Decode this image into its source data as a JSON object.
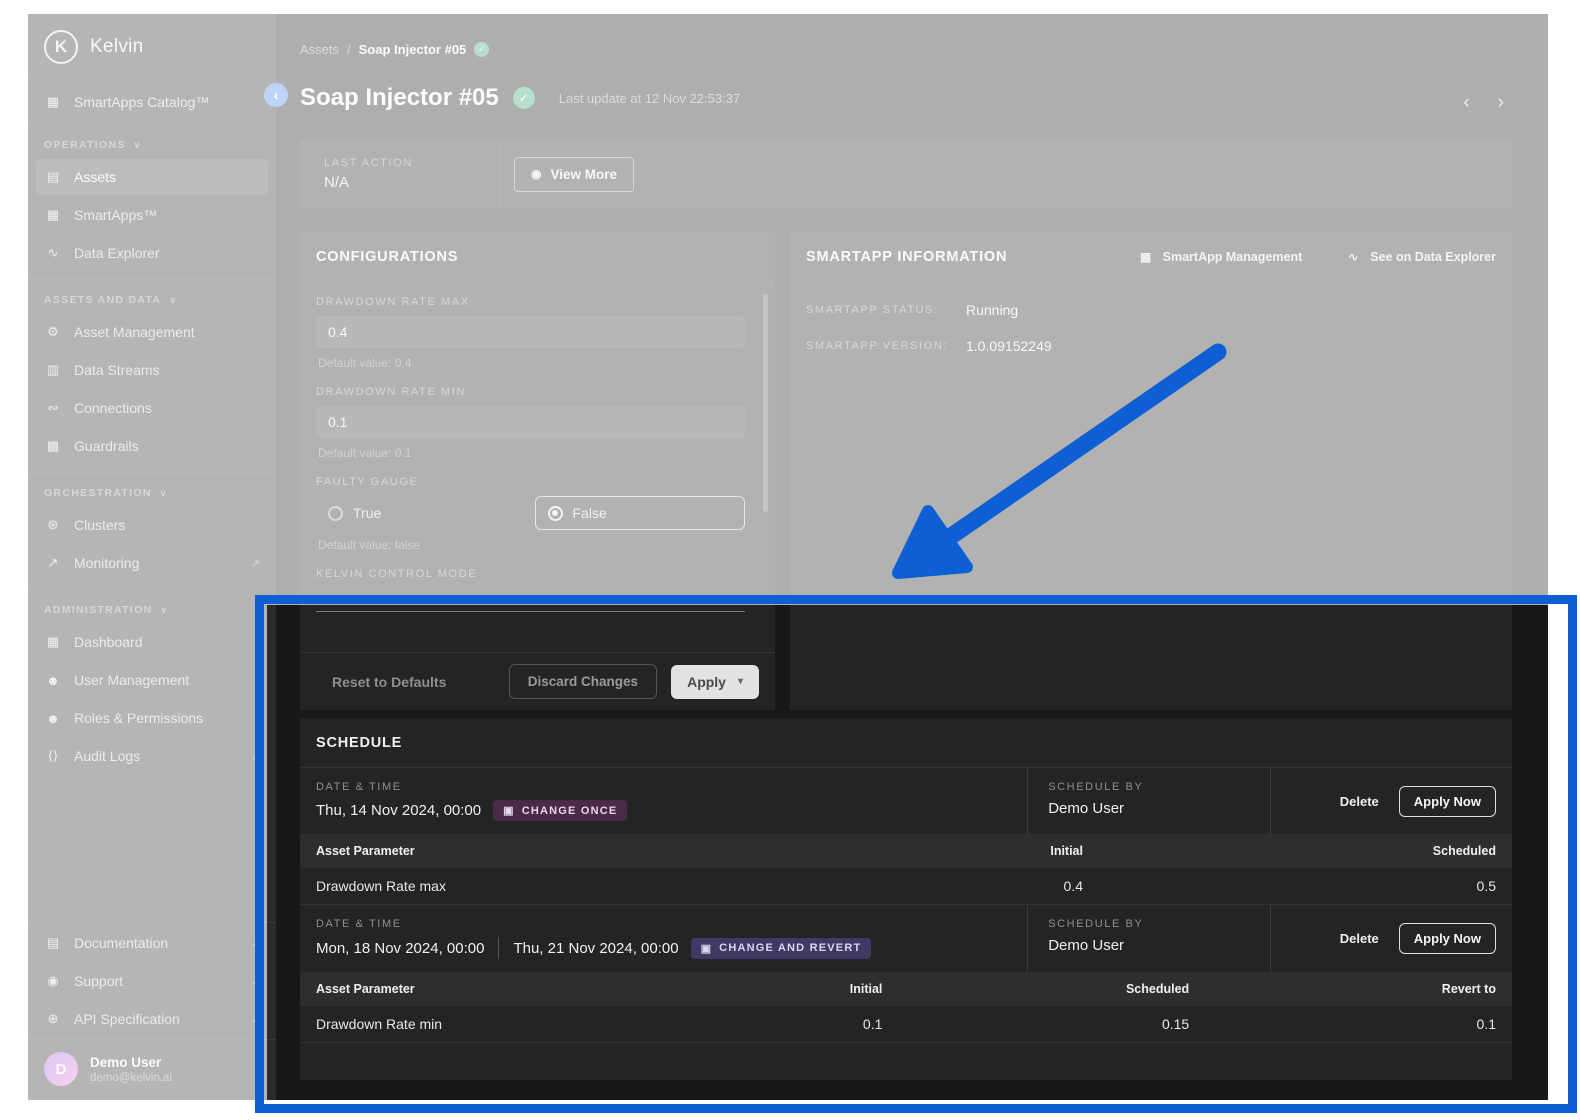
{
  "colors": {
    "annotation_blue": "#0d5fd3",
    "badge_change_once_bg": "#4a2949",
    "badge_change_revert_bg": "#3e3a63",
    "status_green": "#35a36f",
    "avatar_gradient": [
      "#a05fe0",
      "#e879c9"
    ]
  },
  "icons": {
    "logo_initial": "K",
    "collapse": "‹",
    "catalog": "▦",
    "chevron_down": "∨",
    "assets": "▤",
    "smartapps": "▦",
    "data_explorer": "∿",
    "asset_management": "⚙",
    "data_streams": "▥",
    "connections": "∾",
    "guardrails": "▩",
    "clusters": "⊛",
    "monitoring": "↗",
    "dashboard": "▦",
    "user_management": "☻",
    "roles_permissions": "☻",
    "audit_logs": "⟨⟩",
    "documentation": "▤",
    "support": "◉",
    "api_specification": "⊕",
    "external_link": "↗",
    "check": "✓",
    "breadcrumb_separator": "/",
    "prev": "‹",
    "next": "›",
    "eye": "◉",
    "calendar": "▣",
    "caret_down": "▾"
  },
  "sidebar": {
    "logo_text": "Kelvin",
    "catalog_label": "SmartApps Catalog™",
    "sections": [
      {
        "label": "OPERATIONS",
        "items": [
          {
            "label": "Assets"
          },
          {
            "label": "SmartApps™"
          },
          {
            "label": "Data Explorer"
          }
        ]
      },
      {
        "label": "ASSETS AND DATA",
        "items": [
          {
            "label": "Asset Management"
          },
          {
            "label": "Data Streams"
          },
          {
            "label": "Connections"
          },
          {
            "label": "Guardrails"
          }
        ]
      },
      {
        "label": "ORCHESTRATION",
        "items": [
          {
            "label": "Clusters"
          },
          {
            "label": "Monitoring"
          }
        ]
      },
      {
        "label": "ADMINISTRATION",
        "items": [
          {
            "label": "Dashboard"
          },
          {
            "label": "User Management"
          },
          {
            "label": "Roles & Permissions"
          },
          {
            "label": "Audit Logs"
          }
        ]
      }
    ],
    "footer_links": [
      {
        "label": "Documentation"
      },
      {
        "label": "Support"
      },
      {
        "label": "API Specification"
      }
    ],
    "user": {
      "initial": "D",
      "name": "Demo User",
      "email": "demo@kelvin.ai"
    }
  },
  "header": {
    "breadcrumb_root": "Assets",
    "breadcrumb_current": "Soap Injector #05",
    "title": "Soap Injector #05",
    "last_update": "Last update at 12 Nov 22:53:37"
  },
  "last_action": {
    "label": "LAST ACTION",
    "value": "N/A",
    "view_more_label": "View More"
  },
  "configurations": {
    "title": "CONFIGURATIONS",
    "drawdown_max": {
      "label": "DRAWDOWN RATE MAX",
      "value": "0.4",
      "default": "Default value: 0.4"
    },
    "drawdown_min": {
      "label": "DRAWDOWN RATE MIN",
      "value": "0.1",
      "default": "Default value: 0.1"
    },
    "faulty_gauge": {
      "label": "FAULTY GAUGE",
      "option_true": "True",
      "option_false": "False",
      "selected": "False",
      "default": "Default value: false"
    },
    "kelvin_control_mode_label": "KELVIN CONTROL MODE",
    "reset_label": "Reset to Defaults",
    "discard_label": "Discard Changes",
    "apply_label": "Apply"
  },
  "smartapp": {
    "title": "SMARTAPP INFORMATION",
    "management_link": "SmartApp Management",
    "explorer_link": "See on Data Explorer",
    "status_label": "SMARTAPP STATUS:",
    "status_value": "Running",
    "version_label": "SMARTAPP VERSION:",
    "version_value": "1.0.09152249"
  },
  "schedule": {
    "title": "SCHEDULE",
    "entries": [
      {
        "datetime_label": "DATE & TIME",
        "dates": [
          "Thu, 14 Nov 2024, 00:00"
        ],
        "badge": "CHANGE ONCE",
        "by_label": "SCHEDULE BY",
        "by_value": "Demo User",
        "delete_label": "Delete",
        "apply_now_label": "Apply Now",
        "table": {
          "headers": [
            "Asset Parameter",
            "Initial",
            "Scheduled"
          ],
          "rows": [
            [
              "Drawdown Rate max",
              "0.4",
              "0.5"
            ]
          ]
        }
      },
      {
        "datetime_label": "DATE & TIME",
        "dates": [
          "Mon, 18 Nov 2024, 00:00",
          "Thu, 21 Nov 2024, 00:00"
        ],
        "badge": "CHANGE AND REVERT",
        "by_label": "SCHEDULE BY",
        "by_value": "Demo User",
        "delete_label": "Delete",
        "apply_now_label": "Apply Now",
        "table": {
          "headers": [
            "Asset Parameter",
            "Initial",
            "Scheduled",
            "Revert to"
          ],
          "rows": [
            [
              "Drawdown Rate min",
              "0.1",
              "0.15",
              "0.1"
            ]
          ]
        }
      }
    ]
  }
}
